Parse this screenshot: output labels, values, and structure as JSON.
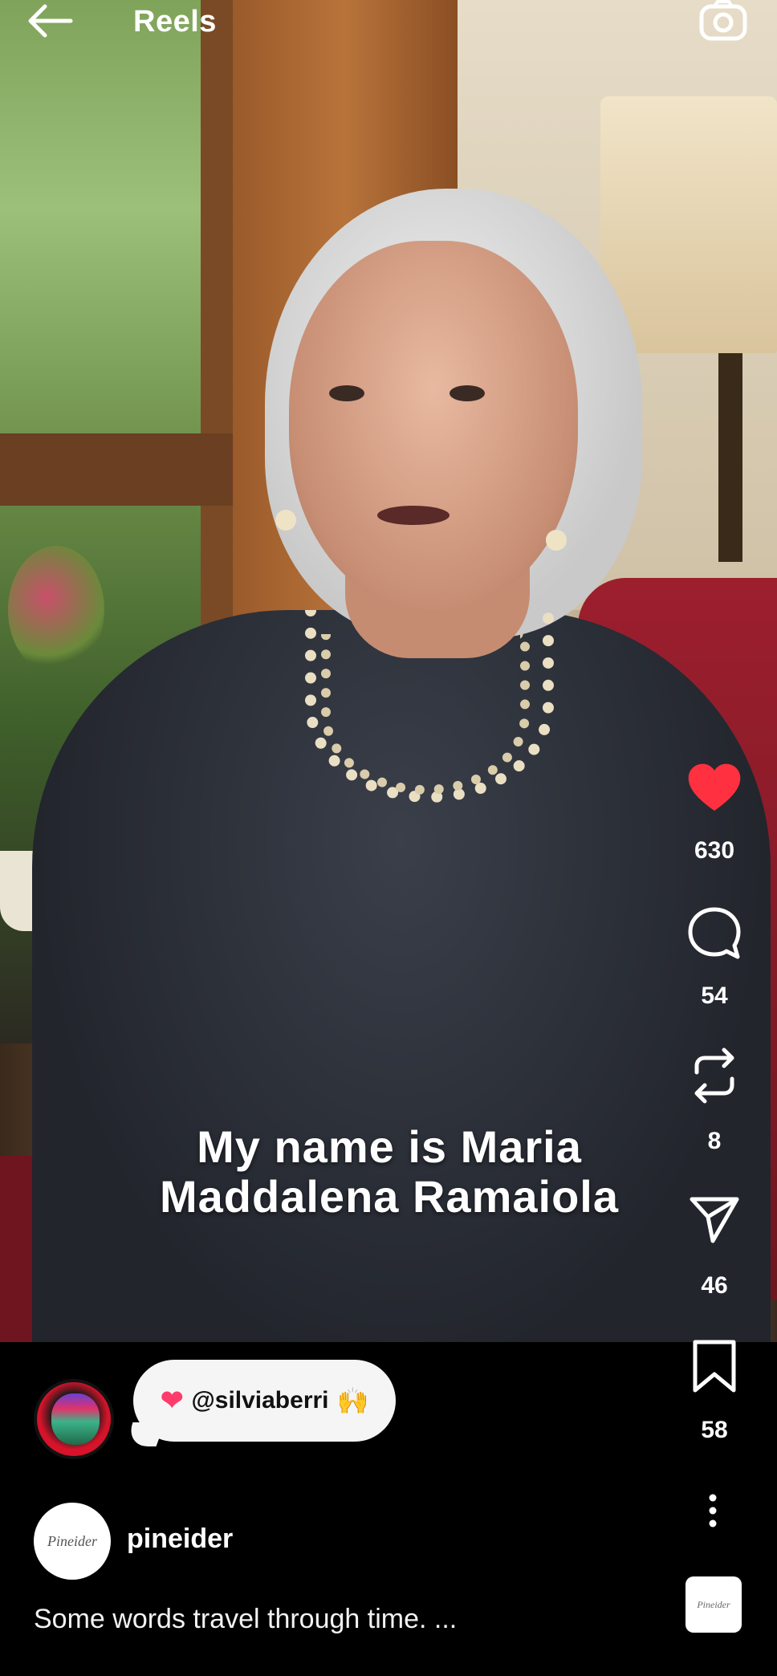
{
  "header": {
    "title": "Reels"
  },
  "video": {
    "caption_line1": "My name is Maria",
    "caption_line2": "Maddalena Ramaiola"
  },
  "actions": {
    "like_count": "630",
    "comment_count": "54",
    "repost_count": "8",
    "share_count": "46",
    "save_count": "58",
    "like_color": "#ff3040"
  },
  "mention_bubble": {
    "heart": "❤",
    "handle": "@silviaberri",
    "hands": "🙌"
  },
  "post": {
    "username": "pineider",
    "avatar_text": "Pineider",
    "description": "Some words travel through time. ...",
    "audio_thumb_text": "Pineider"
  },
  "icons": {
    "back": "arrow-left-icon",
    "camera": "camera-icon",
    "like": "heart-filled-icon",
    "comment": "comment-bubble-icon",
    "repost": "repost-arrows-icon",
    "share": "send-icon",
    "save": "bookmark-icon",
    "more": "more-vertical-icon"
  }
}
